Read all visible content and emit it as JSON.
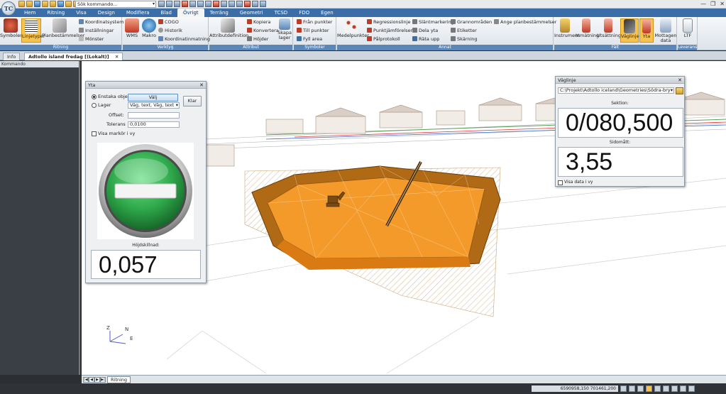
{
  "app": {
    "logo_text": "TC",
    "command_placeholder": "Sök kommando..."
  },
  "window_controls": {
    "minimize": "—",
    "maximize": "❐",
    "close": "✕"
  },
  "ribbon_tabs": [
    "Hem",
    "Ritning",
    "Visa",
    "Design",
    "Modifiera",
    "Blad",
    "Övrigt",
    "Terräng",
    "Geometri",
    "TCSD",
    "FDO",
    "Egen"
  ],
  "active_tab": "Övrigt",
  "ribbon": {
    "ritning": {
      "label": "Ritning",
      "symboler": "Symboler",
      "linjetyper": "Linjetyper",
      "planbest": "Planbestämmelser",
      "koordinatsystem": "Koordinatsystem",
      "installningar": "Inställningar",
      "monster": "Mönster"
    },
    "verktyg": {
      "label": "Verktyg",
      "wms": "WMS",
      "makro": "Makro",
      "cogo": "COGO",
      "historik": "Historik",
      "koordinatinmatning": "Koordinatinmatning"
    },
    "attribut": {
      "label": "Attribut",
      "attributdefinition": "Attributdefinition",
      "kopiera": "Kopiera",
      "konvertera": "Konvertera",
      "hojder": "Höjder",
      "skapa": "Skapa",
      "lager": "lager"
    },
    "symboler": {
      "label": "Symboler",
      "fran_punkter": "Från punkter",
      "till_punkter": "Till punkter",
      "fyll_area": "Fyll area"
    },
    "annat": {
      "label": "Annat",
      "medelpunkter": "Medelpunkter",
      "regressionslinje": "Regressionslinje",
      "punktjamforelser": "Punktjämförelser",
      "palprotokoll": "Pålprotokoll",
      "slantmarkering": "Släntmarkering",
      "dela_yta": "Dela yta",
      "rata_upp": "Räta upp",
      "grannomraden": "Grannområden",
      "etiketter": "Etiketter",
      "skarning": "Skärning",
      "ange_planbest": "Ange planbestämmelser"
    },
    "falt": {
      "label": "Fält",
      "instrument": "Instrument",
      "inmatning": "Inmätning",
      "utsattning": "Utsättning",
      "vaglinje": "Väglinje",
      "yta": "Yta",
      "mottagen": "Mottagen",
      "data": "data"
    },
    "leverans": {
      "label": "Leverans",
      "ltf": "LTF"
    }
  },
  "doc_tabs": {
    "info": "Info",
    "active": "Adtollo island fredag [(Lokalt)]",
    "close": "✕"
  },
  "left_panel": {
    "title": "Kommando"
  },
  "bottom": {
    "sheet": "Ritning",
    "nav": [
      "|◀",
      "◀",
      "▶",
      "▶|"
    ]
  },
  "status": {
    "coordinates": "6590958,150 701461,200"
  },
  "axes": {
    "z": "Z",
    "n": "N",
    "e": "E"
  },
  "yta_panel": {
    "title": "Yta",
    "close": "✕",
    "enstaka_label": "Enstaka objekt",
    "valj_button": "Välj",
    "klar_button": "Klar",
    "lager_label": "Lager",
    "lager_value": "Väg, text, Väg, text",
    "offset_label": "Offset:",
    "offset_value": "",
    "tolerans_label": "Tolerans",
    "tolerans_value": "0,0100",
    "visa_markor_label": "Visa markör i vy",
    "hojdskillnad_label": "Höjdskillnad:",
    "hojdskillnad_value": "0,057",
    "status_icon": "no-entry-icon",
    "status_color": "#2ea84a"
  },
  "vaglinje_panel": {
    "title": "Väglinje",
    "close": "✕",
    "path": "C:\\Projekt\\Adtollo iceland\\Geometries\\Södra-bryggan-nya-v",
    "sektion_label": "Sektion:",
    "sektion_value": "0/080,500",
    "sidomatt_label": "Sidomått:",
    "sidomatt_value": "3,55",
    "visa_data_label": "Visa data i vy"
  },
  "colors": {
    "accent": "#3b6ea7",
    "fill_orange": "#f39a2b",
    "highlight": "#f7c34c"
  }
}
